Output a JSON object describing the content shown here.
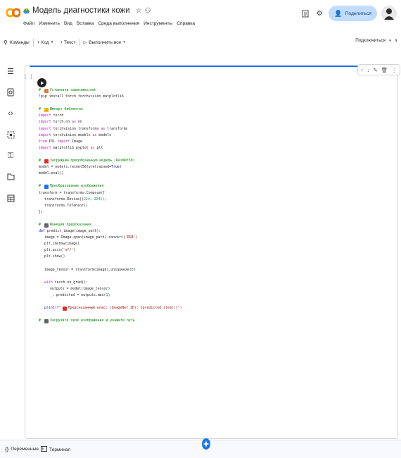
{
  "app": {
    "title": "Модель диагностики кожи",
    "menu": [
      "Файл",
      "Изменить",
      "Вид",
      "Вставка",
      "Среда выполнения",
      "Инструменты",
      "Справка"
    ],
    "share_label": "Поделиться",
    "accent": "#1a73e8"
  },
  "toolbar": {
    "commands_label": "Команды",
    "code_label": "+ Код",
    "text_label": "+ Текст",
    "run_all_label": "Выполнить все",
    "connect_label": "Подключиться"
  },
  "cell": {
    "exec_count": "[ ]",
    "lines": [
      {
        "indent": 0,
        "parts": [
          {
            "t": "# ",
            "c": "cm"
          },
          {
            "emoji": "#e07b39"
          },
          {
            "t": "Установка зависимостей",
            "c": "cm"
          }
        ]
      },
      {
        "indent": 0,
        "parts": [
          {
            "t": "!pip install torch torchvision matplotlib",
            "c": ""
          }
        ]
      },
      {
        "indent": 0,
        "parts": []
      },
      {
        "indent": 0,
        "parts": [
          {
            "t": "# ",
            "c": "cm"
          },
          {
            "emoji": "#f2b000"
          },
          {
            "t": "Импорт библиотек",
            "c": "cm"
          }
        ]
      },
      {
        "indent": 0,
        "parts": [
          {
            "t": "import",
            "c": "kw"
          },
          {
            "t": " torch",
            "c": ""
          }
        ]
      },
      {
        "indent": 0,
        "parts": [
          {
            "t": "import",
            "c": "kw"
          },
          {
            "t": " torch.nn ",
            "c": ""
          },
          {
            "t": "as",
            "c": "kw"
          },
          {
            "t": " nn",
            "c": ""
          }
        ]
      },
      {
        "indent": 0,
        "parts": [
          {
            "t": "import",
            "c": "kw"
          },
          {
            "t": " torchvision.transforms ",
            "c": ""
          },
          {
            "t": "as",
            "c": "kw"
          },
          {
            "t": " transforms",
            "c": ""
          }
        ]
      },
      {
        "indent": 0,
        "parts": [
          {
            "t": "import",
            "c": "kw"
          },
          {
            "t": " torchvision.models ",
            "c": ""
          },
          {
            "t": "as",
            "c": "kw"
          },
          {
            "t": " models",
            "c": ""
          }
        ]
      },
      {
        "indent": 0,
        "parts": [
          {
            "t": "from",
            "c": "kw"
          },
          {
            "t": " PIL ",
            "c": ""
          },
          {
            "t": "import",
            "c": "kw"
          },
          {
            "t": " Image",
            "c": ""
          }
        ]
      },
      {
        "indent": 0,
        "parts": [
          {
            "t": "import",
            "c": "kw"
          },
          {
            "t": " matplotlib.pyplot ",
            "c": ""
          },
          {
            "t": "as",
            "c": "kw"
          },
          {
            "t": " plt",
            "c": ""
          }
        ]
      },
      {
        "indent": 0,
        "parts": []
      },
      {
        "indent": 0,
        "parts": [
          {
            "t": "# ",
            "c": "cm"
          },
          {
            "emoji": "#d93025"
          },
          {
            "t": "Загружаем предобученную модель (ResNet50)",
            "c": "cm"
          }
        ]
      },
      {
        "indent": 0,
        "parts": [
          {
            "t": "model = models.resnet50(pretrained=",
            "c": ""
          },
          {
            "t": "True",
            "c": "kb"
          },
          {
            "t": ")",
            "c": ""
          }
        ]
      },
      {
        "indent": 0,
        "parts": [
          {
            "t": "model.eval()",
            "c": ""
          }
        ]
      },
      {
        "indent": 0,
        "parts": []
      },
      {
        "indent": 0,
        "parts": [
          {
            "t": "# ",
            "c": "cm"
          },
          {
            "emoji": "#1a73e8"
          },
          {
            "t": "Преобразование изображения",
            "c": "cm"
          }
        ]
      },
      {
        "indent": 0,
        "parts": [
          {
            "t": "transform = transforms.Compose([",
            "c": ""
          }
        ]
      },
      {
        "indent": 1,
        "parts": [
          {
            "t": "transforms.Resize((",
            "c": ""
          },
          {
            "t": "224",
            "c": "num"
          },
          {
            "t": ", ",
            "c": ""
          },
          {
            "t": "224",
            "c": "num"
          },
          {
            "t": ")),",
            "c": ""
          }
        ]
      },
      {
        "indent": 1,
        "parts": [
          {
            "t": "transforms.ToTensor()",
            "c": ""
          }
        ]
      },
      {
        "indent": 0,
        "parts": [
          {
            "t": "])",
            "c": ""
          }
        ]
      },
      {
        "indent": 0,
        "parts": []
      },
      {
        "indent": 0,
        "parts": [
          {
            "t": "# ",
            "c": "cm"
          },
          {
            "emoji": "#5f6368"
          },
          {
            "t": "Функция предсказания",
            "c": "cm"
          }
        ]
      },
      {
        "indent": 0,
        "parts": [
          {
            "t": "def",
            "c": "kb"
          },
          {
            "t": " predict_image(image_path):",
            "c": ""
          }
        ]
      },
      {
        "indent": 1,
        "parts": [
          {
            "t": "image = Image.open(image_path).convert(",
            "c": ""
          },
          {
            "t": "'RGB'",
            "c": "str"
          },
          {
            "t": ")",
            "c": ""
          }
        ]
      },
      {
        "indent": 1,
        "parts": [
          {
            "t": "plt.imshow(image)",
            "c": ""
          }
        ]
      },
      {
        "indent": 1,
        "parts": [
          {
            "t": "plt.axis(",
            "c": ""
          },
          {
            "t": "'off'",
            "c": "str"
          },
          {
            "t": ")",
            "c": ""
          }
        ]
      },
      {
        "indent": 1,
        "parts": [
          {
            "t": "plt.show()",
            "c": ""
          }
        ]
      },
      {
        "indent": 0,
        "parts": []
      },
      {
        "indent": 1,
        "parts": [
          {
            "t": "image_tensor = transform(image).unsqueeze(",
            "c": ""
          },
          {
            "t": "0",
            "c": "num"
          },
          {
            "t": ")",
            "c": ""
          }
        ]
      },
      {
        "indent": 0,
        "parts": []
      },
      {
        "indent": 1,
        "parts": [
          {
            "t": "with",
            "c": "kw"
          },
          {
            "t": " torch.no_grad():",
            "c": ""
          }
        ]
      },
      {
        "indent": 2,
        "parts": [
          {
            "t": "outputs = model(image_tensor)",
            "c": ""
          }
        ]
      },
      {
        "indent": 2,
        "parts": [
          {
            "t": "_, predicted = outputs.max(",
            "c": ""
          },
          {
            "t": "1",
            "c": "num"
          },
          {
            "t": ")",
            "c": ""
          }
        ]
      },
      {
        "indent": 0,
        "parts": []
      },
      {
        "indent": 1,
        "parts": [
          {
            "t": "print",
            "c": "kb"
          },
          {
            "t": "(f\"",
            "c": "str"
          },
          {
            "emoji": "#d93025"
          },
          {
            "t": "Предсказанный класс (ImageNet ID): {predicted.item()}\")",
            "c": "str"
          }
        ]
      },
      {
        "indent": 0,
        "parts": []
      },
      {
        "indent": 0,
        "parts": [
          {
            "t": "# ",
            "c": "cm"
          },
          {
            "emoji": "#5f6368"
          },
          {
            "t": "Загрузите своё изображение и укажите путь",
            "c": "cm"
          }
        ]
      }
    ]
  },
  "bottom": {
    "variables_label": "Переменные",
    "terminal_label": "Терминал"
  }
}
